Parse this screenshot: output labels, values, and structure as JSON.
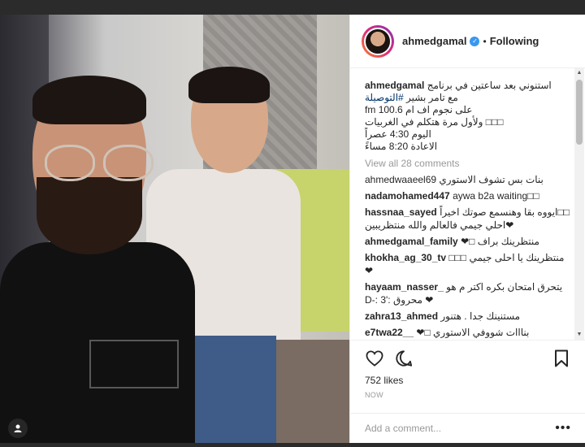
{
  "post": {
    "username": "ahmedgamal",
    "follow_status": "Following",
    "separator": "•",
    "caption": {
      "username": "ahmedgamal",
      "line1": "استنوني بعد ساعتين في برنامج",
      "hashtag": "#التوصيلة",
      "line2": "مع تامر بشير",
      "line3": "على نجوم اف ام 100.6 fm",
      "line4": "□□□ ولأول مرة هتكلم في الغربيات",
      "line5": "اليوم 4:30 عصراً",
      "line6": "الاعادة 8:20 مساءً"
    },
    "view_all_comments": "View all 28 comments",
    "comments": [
      {
        "text": "بنات بس تشوف الاستوري ahmedwaaeel69"
      },
      {
        "username": "nadamohamed447",
        "text": "aywa b2a waiting□□"
      },
      {
        "username": "hassnaa_sayed",
        "text": "ايووه بقا وهنسمع صوتك اخيراً□□",
        "text2": "❤احلي جيمي فالعالم والله منتظريبين"
      },
      {
        "username": "ahmedgamal_family",
        "text": "❤□ منتظرينك براف"
      },
      {
        "username": "khokha_ag_30_tv",
        "text": "□□□ منتظرينك يا احلى جيمي❤"
      },
      {
        "username": "hayaam_nasser_",
        "text": "يتحرق امتحان بكره اكتر م هو",
        "text2": "D-: 3': محروق ❤"
      },
      {
        "username": "zahra13_ahmed",
        "text": "مستنينك جدا . هتنور"
      },
      {
        "username": "e7twa22__",
        "text": "❤□ بنااات شووفي الاستوري"
      }
    ],
    "likes": "752 likes",
    "time_ago": "NOW",
    "add_comment_placeholder": "Add a comment...",
    "more_options": "•••"
  },
  "icons": {
    "verified": "verified-badge-icon",
    "heart": "heart-icon",
    "comment": "comment-bubble-icon",
    "bookmark": "bookmark-icon",
    "user_tag": "user-tag-icon"
  },
  "colors": {
    "verified": "#3897f0",
    "hashtag": "#003569",
    "muted": "#999999"
  }
}
